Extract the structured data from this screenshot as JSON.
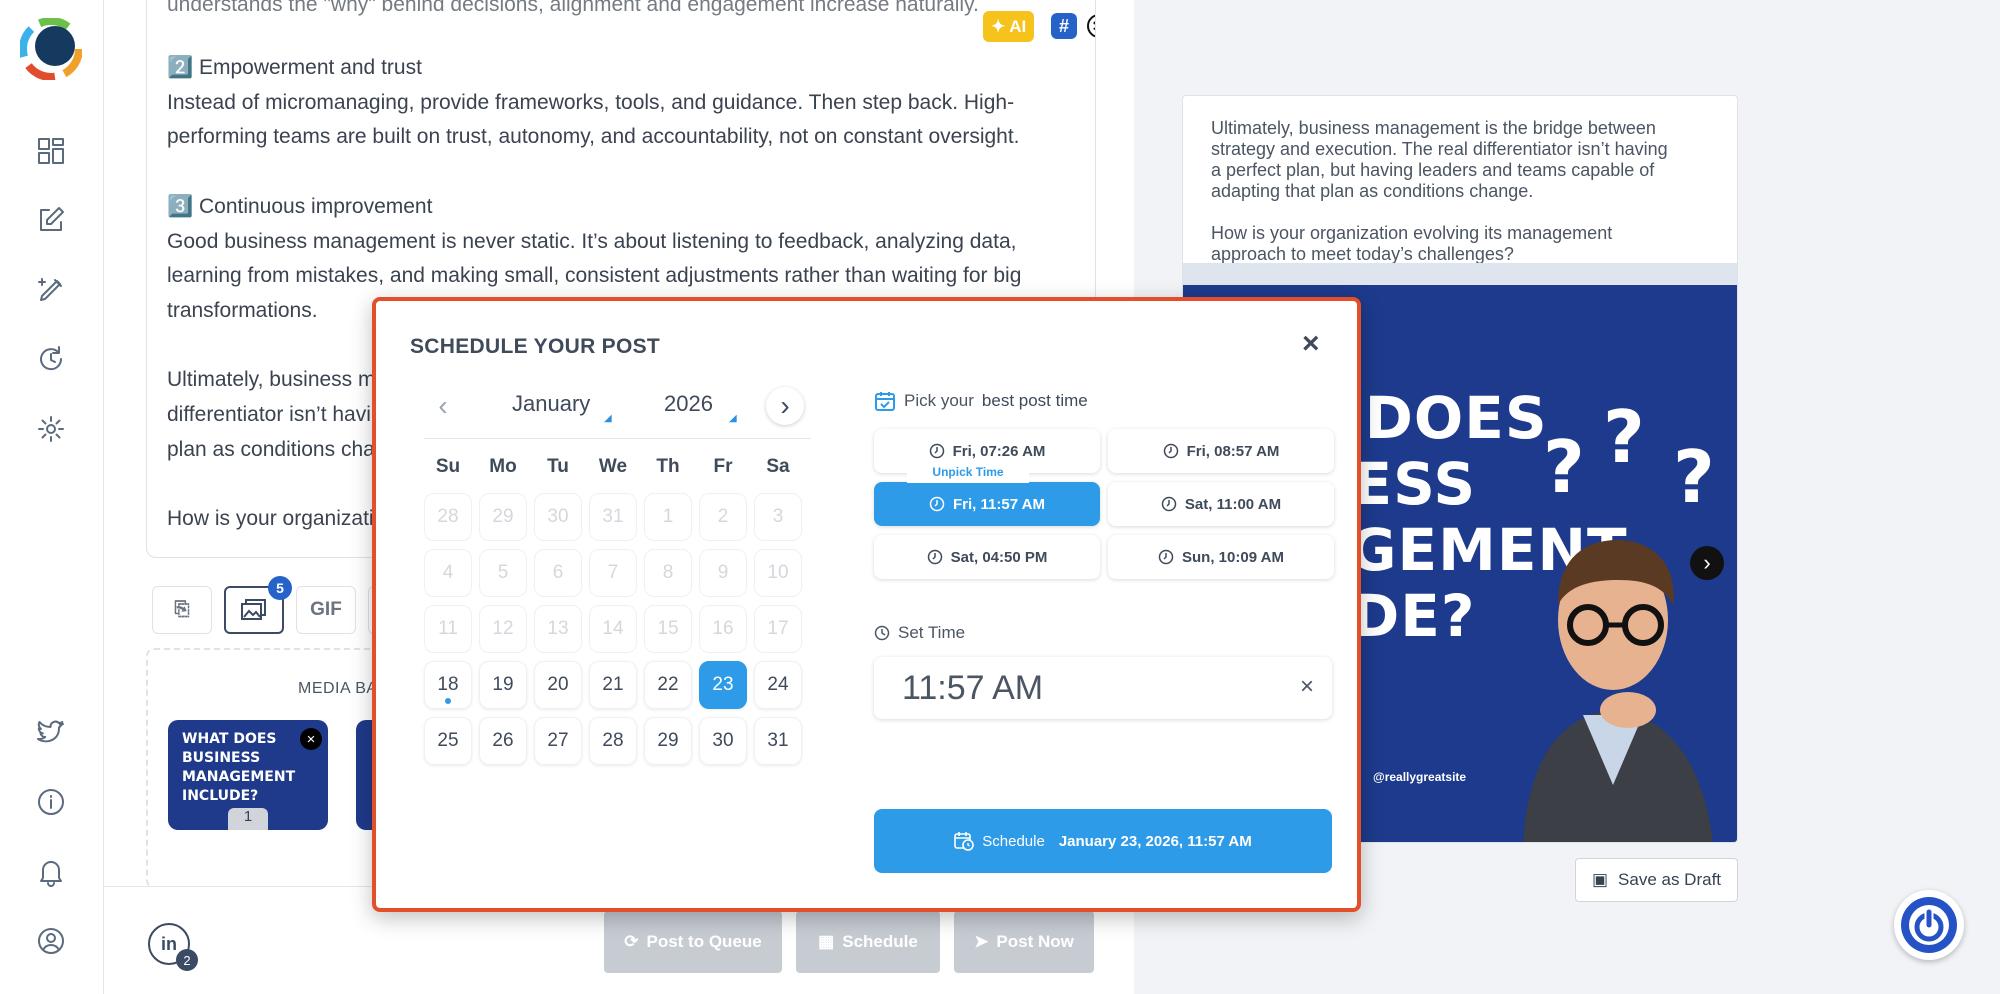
{
  "sidebar": {
    "icons": [
      "dashboard-icon",
      "compose-icon",
      "edit-pen-icon",
      "sync-icon",
      "settings-icon",
      "twitter-icon",
      "info-icon",
      "bell-icon",
      "user-icon"
    ]
  },
  "editor": {
    "top_fragment": "understands the \"why\" behind decisions, alignment and engagement increase naturally.",
    "body": "2️⃣ Empowerment and trust\nInstead of micromanaging, provide frameworks, tools, and guidance. Then step back. High-\nperforming teams are built on trust, autonomy, and accountability, not on constant oversight.\n\n3️⃣ Continuous improvement\nGood business management is never static. It’s about listening to feedback, analyzing data,\nlearning from mistakes, and making small, consistent adjustments rather than waiting for big\ntransformations.\n\nUltimately, business ma\ndifferentiator isn’t havi\nplan as conditions char\n\nHow is your organizati",
    "ai_label": "AI",
    "hash_label": "#"
  },
  "toolbar": {
    "gif_label": "GIF",
    "media_count": "5"
  },
  "media": {
    "label": "MEDIA BA",
    "thumb_title": "WHAT DOES\nBUSINESS\nMANAGEMENT\nINCLUDE?",
    "thumb_index": "1",
    "close_label": "×"
  },
  "footer": {
    "account_initials": "in",
    "account_count": "2",
    "post_queue": "Post to Queue",
    "schedule": "Schedule",
    "post_now": "Post Now"
  },
  "preview": {
    "text": "Ultimately, business management is the bridge between\nstrategy and execution. The real differentiator isn’t having\na perfect plan, but having leaders and teams capable of\nadapting that plan as conditions change.\n\nHow is your organization evolving its management\napproach to meet today’s challenges?",
    "headline": "T DOES\nNESS\nAGEMENT\nUDE?",
    "handle": "@reallygreatsite",
    "save_draft": "Save as Draft"
  },
  "modal": {
    "title": "SCHEDULE YOUR POST",
    "close": "×",
    "month": "January",
    "year": "2026",
    "weekdays": [
      "Su",
      "Mo",
      "Tu",
      "We",
      "Th",
      "Fr",
      "Sa"
    ],
    "pick_prefix": "Pick your",
    "pick_suffix": "best post time",
    "unpick_label": "Unpick Time",
    "slots": [
      "Fri, 07:26 AM",
      "Fri, 08:57 AM",
      "Fri, 11:57 AM",
      "Sat, 11:00 AM",
      "Sat, 04:50 PM",
      "Sun, 10:09 AM"
    ],
    "selected_slot": "Fri, 11:57 AM",
    "set_time_label": "Set Time",
    "time_value": "11:57 AM",
    "time_clear": "×",
    "schedule_label": "Schedule",
    "schedule_when": "January 23, 2026, 11:57 AM",
    "selected_day": "23",
    "today": "18",
    "disabled_days": [
      "28",
      "29",
      "30",
      "31",
      "1",
      "2",
      "3",
      "4",
      "5",
      "6",
      "7",
      "8",
      "9",
      "10",
      "11",
      "12",
      "13",
      "14",
      "15",
      "16",
      "17"
    ],
    "active_days": [
      "18",
      "19",
      "20",
      "21",
      "22",
      "23",
      "24",
      "25",
      "26",
      "27",
      "28",
      "29",
      "30",
      "31"
    ]
  },
  "colors": {
    "accent": "#2e9be8",
    "modal_border": "#e1502a",
    "brand_dark": "#1d3a8c"
  }
}
